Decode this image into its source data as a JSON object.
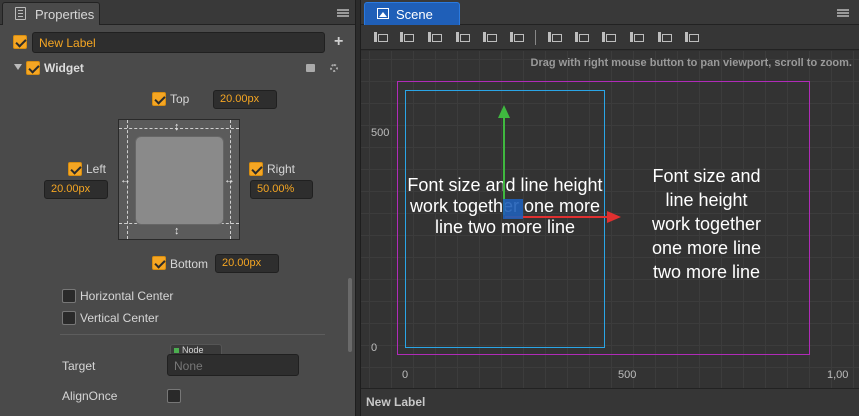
{
  "properties_panel": {
    "tab_label": "Properties",
    "node_name": "New Label",
    "widget_label": "Widget",
    "top_label": "Top",
    "top_value": "20.00px",
    "left_label": "Left",
    "left_value": "20.00px",
    "right_label": "Right",
    "right_value": "50.00%",
    "bottom_label": "Bottom",
    "bottom_value": "20.00px",
    "horizontal_center_label": "Horizontal Center",
    "vertical_center_label": "Vertical Center",
    "target_label": "Target",
    "target_tag": "Node",
    "target_placeholder": "None",
    "align_once_label": "AlignOnce",
    "plus_symbol": "+"
  },
  "scene_panel": {
    "tab_label": "Scene",
    "hint": "Drag with right mouse button to pan viewport, scroll to zoom.",
    "y_axis_labels": [
      "500",
      "0"
    ],
    "x_axis_labels": [
      "0",
      "500",
      "1,00"
    ],
    "label_text_left": "Font size and line height work together one more line two more line",
    "label_text_right": "Font size and line height work together one more line two more line",
    "status_text": "New Label"
  },
  "colors": {
    "accent": "#f5a623",
    "scene_tab": "#1f5fb8",
    "design_rect": "#b02bb8",
    "node_rect": "#2aa5e6",
    "gizmo_x": "#e03030",
    "gizmo_y": "#3fb83f"
  }
}
